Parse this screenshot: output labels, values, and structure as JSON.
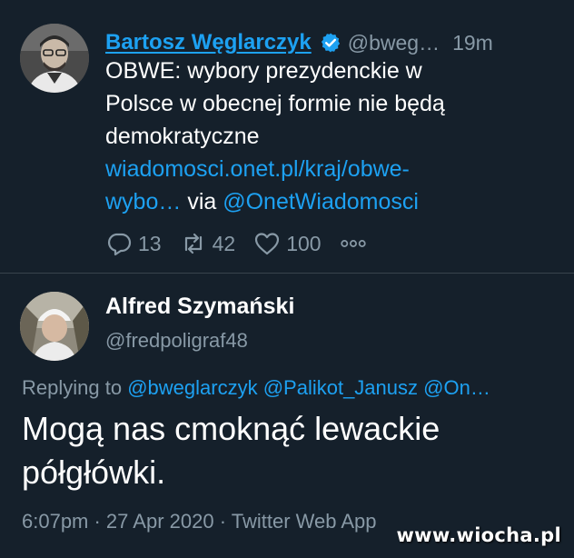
{
  "tweet": {
    "author_name": "Bartosz Węglarczyk",
    "handle": "@bweg…",
    "time": "19m",
    "text_line1": "OBWE: wybory prezydenckie w",
    "text_line2": "Polsce w obecnej formie nie będą",
    "text_line3": "demokratyczne",
    "link_line1": "wiadomosci.onet.pl/kraj/obwe-",
    "link_line2": "wybo…",
    "via": " via ",
    "via_mention": "@OnetWiadomosci",
    "replies": "13",
    "retweets": "42",
    "likes": "100"
  },
  "reply": {
    "author_name": "Alfred Szymański",
    "handle": "@fredpoligraf48",
    "replying_prefix": "Replying to ",
    "mentions": [
      "@bweglarczyk",
      "@Palikot_Janusz",
      "@On…"
    ],
    "text_line1": "Mogą nas cmoknąć lewackie",
    "text_line2": "półgłówki.",
    "meta": "6:07pm · 27 Apr 2020 · Twitter Web App"
  },
  "watermark": "www.wiocha.pl",
  "icons": {
    "verified": "verified-badge-icon",
    "reply": "reply-icon",
    "retweet": "retweet-icon",
    "like": "heart-icon",
    "more": "more-dots-icon"
  },
  "colors": {
    "background": "#15202b",
    "link": "#1da1f2",
    "secondary_text": "#8899a6",
    "divider": "#38444d"
  }
}
